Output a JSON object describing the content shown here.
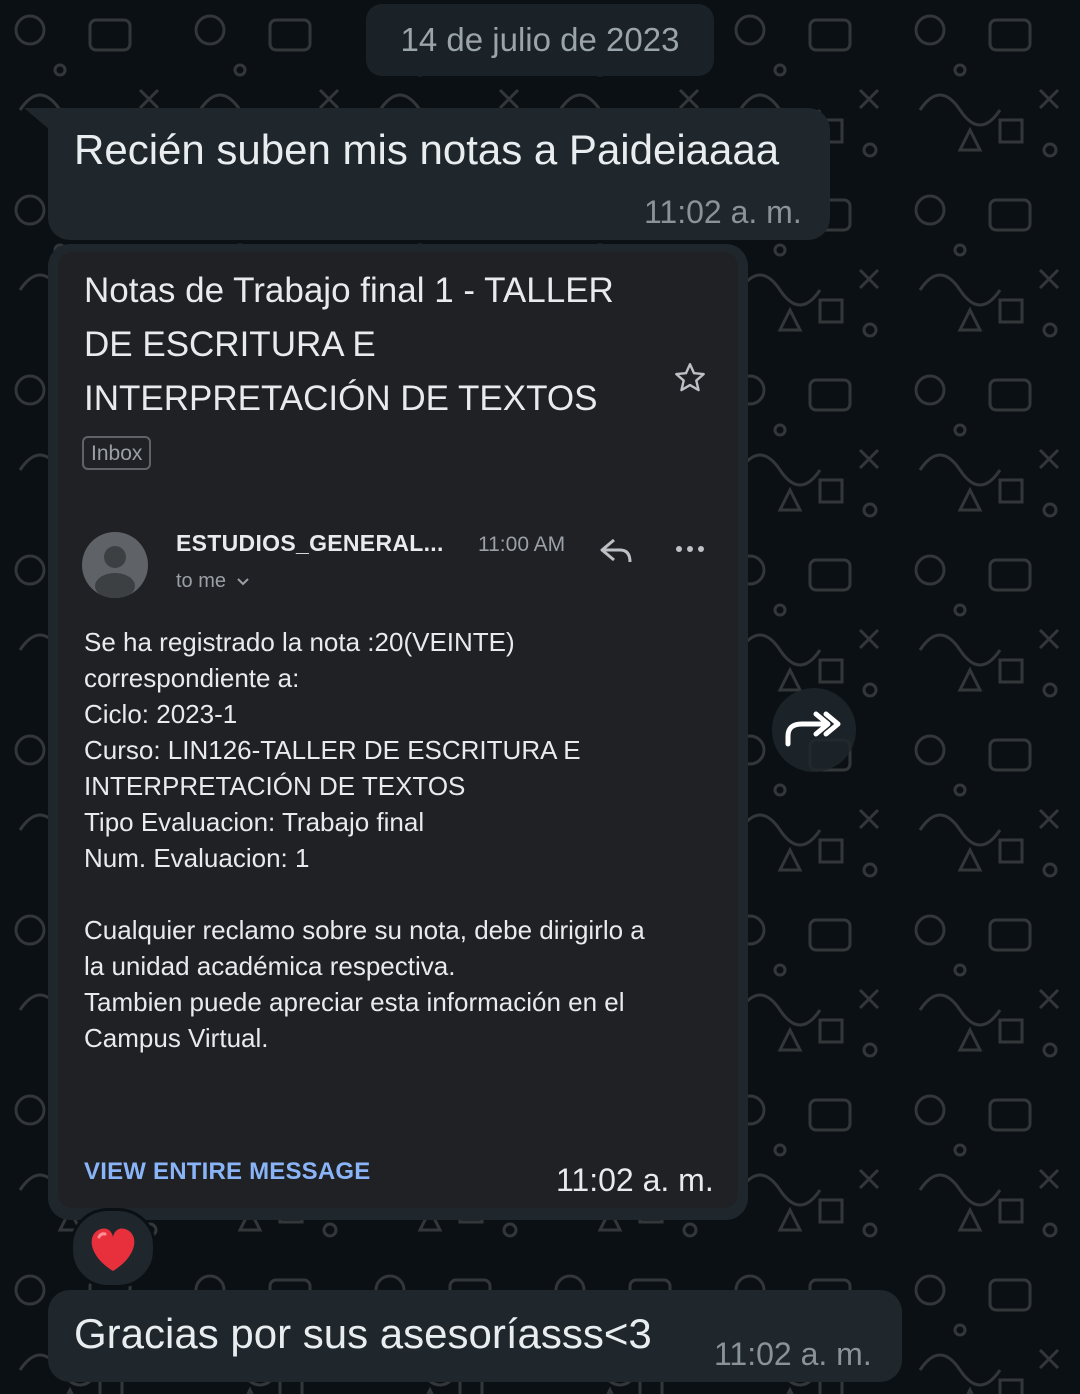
{
  "date_separator": "14 de julio de 2023",
  "messages": [
    {
      "text": "Recién suben mis notas a Paideiaaaa",
      "time": "11:02 a. m."
    },
    {
      "time": "11:02 a. m.",
      "email": {
        "subject": "Notas de Trabajo final 1 - TALLER DE ESCRITURA E INTERPRETACIÓN DE TEXTOS",
        "label": "Inbox",
        "sender": "ESTUDIOS_GENERAL...",
        "sent_time": "11:00 AM",
        "recipient": "to me",
        "body_lines": [
          "Se ha registrado la nota :20(VEINTE)",
          "correspondiente a:",
          "Ciclo: 2023-1",
          "Curso: LIN126-TALLER DE ESCRITURA E",
          "INTERPRETACIÓN DE TEXTOS",
          "Tipo Evaluacion: Trabajo final",
          "Num. Evaluacion: 1"
        ],
        "body_lines_2": [
          "Cualquier reclamo sobre su nota, debe dirigirlo a",
          "la unidad académica respectiva.",
          "Tambien puede apreciar esta información en el",
          "Campus Virtual."
        ],
        "view_link": "VIEW ENTIRE MESSAGE"
      },
      "reaction": "❤️"
    },
    {
      "text": "Gracias por sus asesoríasss<3",
      "time": "11:02 a. m."
    }
  ],
  "colors": {
    "background": "#0b1014",
    "bubble": "#1f272c",
    "email_card": "#202124",
    "link": "#8ab4f8",
    "heart": "#e8303c"
  },
  "icons": [
    "star-icon",
    "reply-icon",
    "more-icon",
    "chevron-down-icon",
    "forward-icon",
    "avatar-icon",
    "heart-icon"
  ]
}
